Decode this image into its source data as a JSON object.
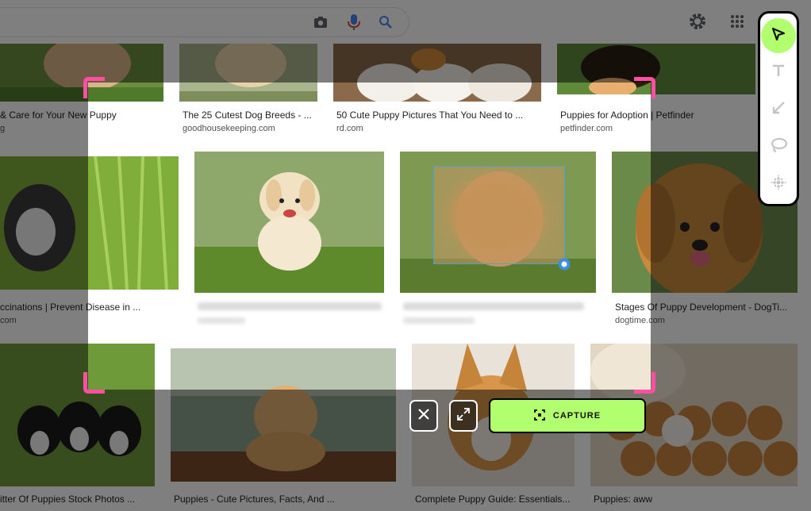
{
  "results": [
    {
      "title": "& Care for Your New Puppy",
      "source": "g"
    },
    {
      "title": "The 25 Cutest Dog Breeds - ...",
      "source": "goodhousekeeping.com"
    },
    {
      "title": "50 Cute Puppy Pictures That You Need to ...",
      "source": "rd.com"
    },
    {
      "title": "Puppies for Adoption | Petfinder",
      "source": "petfinder.com"
    },
    {
      "title": "ccinations | Prevent Disease in ...",
      "source": "com"
    },
    {
      "title": "Stages Of Puppy Development - DogTi...",
      "source": "dogtime.com"
    },
    {
      "title": "itter Of Puppies Stock Photos ...",
      "source": ""
    },
    {
      "title": "Puppies - Cute Pictures, Facts, And ...",
      "source": ""
    },
    {
      "title": "Complete Puppy Guide: Essentials...",
      "source": ""
    },
    {
      "title": "Puppies: aww",
      "source": ""
    }
  ],
  "capture": {
    "label": "CAPTURE"
  },
  "colors": {
    "accent": "#b1ff6e",
    "frame": "#ff4fa0"
  },
  "icons": [
    "camera-icon",
    "mic-icon",
    "search-icon",
    "gear-icon",
    "apps-grid-icon",
    "pointer-icon",
    "text-icon",
    "arrow-icon",
    "lasso-icon",
    "blur-icon",
    "close-icon",
    "expand-icon",
    "capture-icon",
    "blur-handle-icon"
  ]
}
